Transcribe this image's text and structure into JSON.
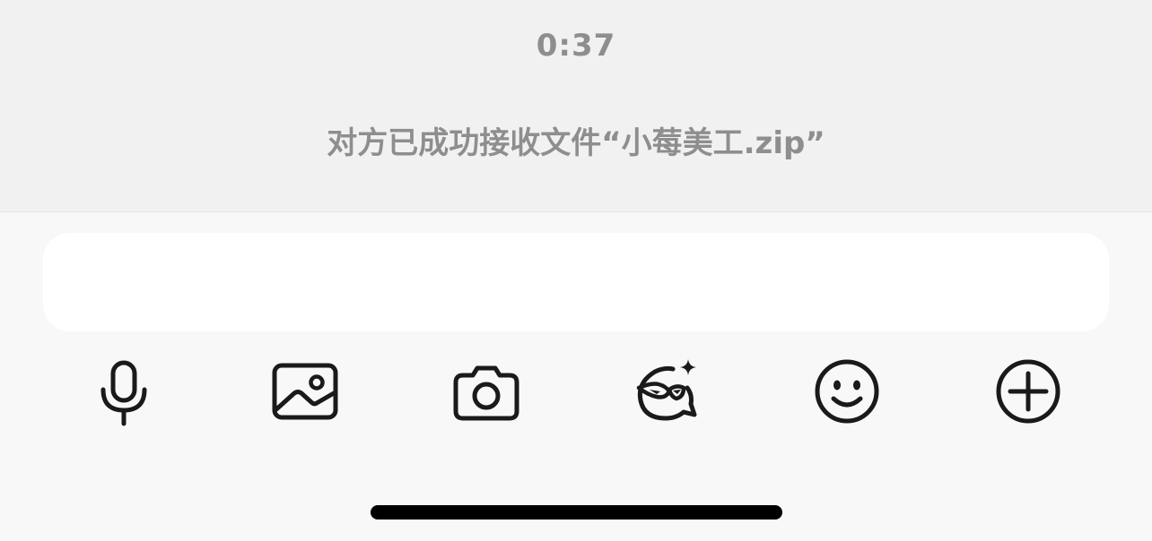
{
  "chat": {
    "timestamp": "0:37",
    "system_message": "对方已成功接收文件“小莓美工.zip”"
  },
  "input": {
    "value": "",
    "placeholder": ""
  },
  "toolbar": {
    "items": [
      {
        "icon": "microphone-icon",
        "action": "voice"
      },
      {
        "icon": "image-icon",
        "action": "photo-album"
      },
      {
        "icon": "camera-icon",
        "action": "camera"
      },
      {
        "icon": "ai-assistant-icon",
        "action": "ai-assistant"
      },
      {
        "icon": "emoji-icon",
        "action": "emoji"
      },
      {
        "icon": "plus-circle-icon",
        "action": "more"
      }
    ],
    "icon_color": "#1a1a1a"
  },
  "colors": {
    "chat_background": "#f1f1f1",
    "panel_background": "#f8f8f8",
    "input_background": "#ffffff",
    "secondary_text": "#8e8e8e"
  }
}
